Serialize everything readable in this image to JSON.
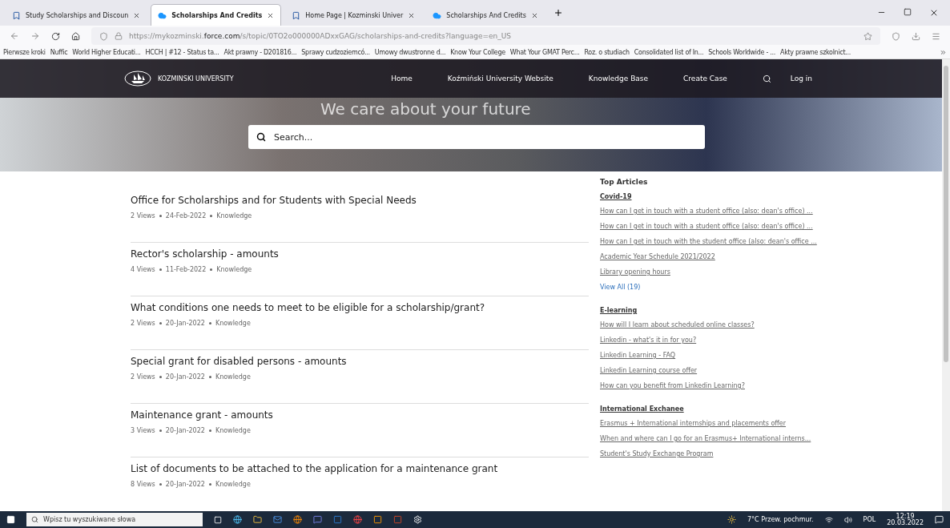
{
  "browser": {
    "tabs": [
      {
        "label": "Study Scholarships and Discoun",
        "selected": false,
        "kind": "site"
      },
      {
        "label": "Scholarships And Credits",
        "selected": true,
        "kind": "cloud"
      },
      {
        "label": "Home Page | Kozminski Univer",
        "selected": false,
        "kind": "site"
      },
      {
        "label": "Scholarships And Credits",
        "selected": false,
        "kind": "cloud"
      }
    ],
    "url_prefix": "https://mykozminski.",
    "url_domain": "force.com",
    "url_rest": "/s/topic/0TO2o000000ADxxGAG/scholarships-and-credits?language=en_US",
    "bookmarks": [
      "Pierwsze kroki",
      "Nuffic",
      "World Higher Educati...",
      "HCCH | #12 - Status ta...",
      "Akt prawny - D201816...",
      "Sprawy cudzoziemcó...",
      "Umowy dwustronne d...",
      "Know Your College",
      "What Your GMAT Perc...",
      "Roz. o studiach",
      "Consolidated list of In...",
      "Schools Worldwide - ...",
      "Akty prawne szkolnict..."
    ]
  },
  "site": {
    "logo_text": "KOZMINSKI UNIVERSITY",
    "nav": [
      "Home",
      "Koźmiński University Website",
      "Knowledge Base",
      "Create Case"
    ],
    "login": "Log in",
    "hero_title": "We care about your future",
    "search": {
      "placeholder": "Search..."
    }
  },
  "articles": [
    {
      "title": "Office for Scholarships and for Students with Special Needs",
      "views": "2 Views",
      "date": "24-Feb-2022",
      "type": "Knowledge"
    },
    {
      "title": "Rector's scholarship - amounts",
      "views": "4 Views",
      "date": "11-Feb-2022",
      "type": "Knowledge"
    },
    {
      "title": "What conditions one needs to meet to be eligible for a scholarship/grant?",
      "views": "2 Views",
      "date": "20-Jan-2022",
      "type": "Knowledge"
    },
    {
      "title": "Special grant for disabled persons - amounts",
      "views": "2 Views",
      "date": "20-Jan-2022",
      "type": "Knowledge"
    },
    {
      "title": "Maintenance grant - amounts",
      "views": "3 Views",
      "date": "20-Jan-2022",
      "type": "Knowledge"
    },
    {
      "title": "List of documents to be attached to the application for a maintenance grant",
      "views": "8 Views",
      "date": "20-Jan-2022",
      "type": "Knowledge"
    }
  ],
  "sidebar": {
    "title": "Top Articles",
    "groups": [
      {
        "name": "Covid-19",
        "links": [
          "How can I get in touch with a student office (also: dean's office) ...",
          "How can I get in touch with a student office (also: dean's office) ...",
          "How can I get in touch with the student office (also: dean's office ...",
          "Academic Year Schedule 2021/2022",
          "Library opening hours"
        ],
        "view_all": "View All (19)"
      },
      {
        "name": "E-learning",
        "links": [
          "How will I learn about scheduled online classes?",
          "Linkedin - what's it in for you?",
          "Linkedin Learning - FAQ",
          "Linkedin Learning course offer",
          "How can you benefit from Linkedin Learning?"
        ]
      },
      {
        "name": "International Exchanee",
        "links": [
          "Erasmus + International internships and placements offer",
          "When and where can I go for an Erasmus+ International interns...",
          "Student's Study Exchange Program"
        ]
      }
    ]
  },
  "taskbar": {
    "search_placeholder": "Wpisz tu wyszukiwane słowa",
    "weather": "7°C  Przew. pochmur.",
    "language": "POL",
    "time": "12:19",
    "date": "20.03.2022"
  }
}
